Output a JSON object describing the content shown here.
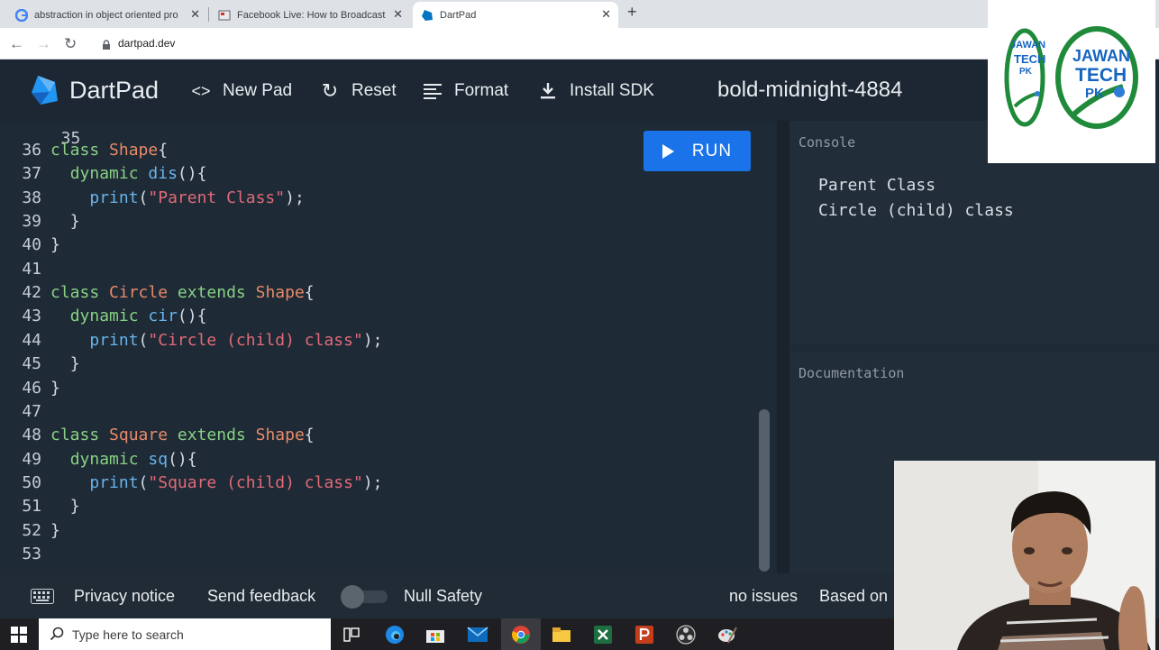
{
  "browser": {
    "tabs": [
      {
        "title": "abstraction in object oriented pro"
      },
      {
        "title": "Facebook Live: How to Broadcast"
      },
      {
        "title": "DartPad"
      }
    ],
    "url": "dartpad.dev",
    "new_tab_symbol": "+",
    "close_symbol": "✕"
  },
  "header": {
    "brand": "DartPad",
    "new_pad": "New Pad",
    "reset": "Reset",
    "format": "Format",
    "install_sdk": "Install SDK",
    "pad_name": "bold-midnight-4884"
  },
  "editor": {
    "partial_line_number": "35",
    "lines": [
      {
        "n": "36",
        "text": "class Shape{"
      },
      {
        "n": "37",
        "text": "  dynamic dis(){"
      },
      {
        "n": "38",
        "text": "    print(\"Parent Class\");"
      },
      {
        "n": "39",
        "text": "  }"
      },
      {
        "n": "40",
        "text": "}"
      },
      {
        "n": "41",
        "text": ""
      },
      {
        "n": "42",
        "text": "class Circle extends Shape{"
      },
      {
        "n": "43",
        "text": "  dynamic cir(){"
      },
      {
        "n": "44",
        "text": "    print(\"Circle (child) class\");"
      },
      {
        "n": "45",
        "text": "  }"
      },
      {
        "n": "46",
        "text": "}"
      },
      {
        "n": "47",
        "text": ""
      },
      {
        "n": "48",
        "text": "class Square extends Shape{"
      },
      {
        "n": "49",
        "text": "  dynamic sq(){"
      },
      {
        "n": "50",
        "text": "    print(\"Square (child) class\");"
      },
      {
        "n": "51",
        "text": "  }"
      },
      {
        "n": "52",
        "text": "}"
      },
      {
        "n": "53",
        "text": ""
      }
    ],
    "run_label": "RUN"
  },
  "console": {
    "title": "Console",
    "output": [
      "Parent Class",
      "Circle (child) class"
    ]
  },
  "documentation": {
    "title": "Documentation"
  },
  "footer": {
    "privacy": "Privacy notice",
    "feedback": "Send feedback",
    "null_safety": "Null Safety",
    "issues": "no issues",
    "based_on": "Based on"
  },
  "taskbar": {
    "search_placeholder": "Type here to search"
  },
  "overlay": {
    "logo_text": [
      "JAWAN",
      "TECH",
      "PK"
    ]
  },
  "colors": {
    "accent": "#1a73e8",
    "keyword": "#89d185",
    "class_name": "#e88a6a",
    "function": "#6ab3ea",
    "string": "#e16a7a"
  }
}
